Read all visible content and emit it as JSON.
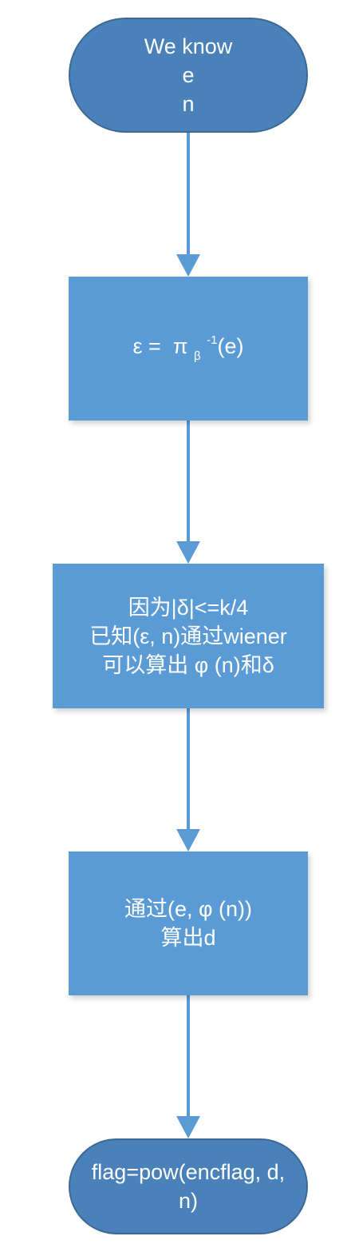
{
  "colors": {
    "terminal_fill": "#4a81b9",
    "terminal_border": "#3c6894",
    "process_fill": "#5b9bd5",
    "arrow": "#5b9bd5",
    "text": "#ffffff"
  },
  "nodes": {
    "start": {
      "lines": [
        "We know",
        "e",
        "n"
      ]
    },
    "epsilon": {
      "prefix": "ε =  π ",
      "subscript": "β",
      "superscript": "-1",
      "suffix": "(e)"
    },
    "wiener": {
      "lines": [
        "因为|δ|<=k/4",
        "已知(ε, n)通过wiener",
        "可以算出 φ (n)和δ"
      ]
    },
    "compute_d": {
      "lines": [
        "通过(e, φ (n))",
        "算出d"
      ]
    },
    "end": {
      "lines": [
        "flag=pow(encflag, d,",
        "n)"
      ]
    }
  }
}
